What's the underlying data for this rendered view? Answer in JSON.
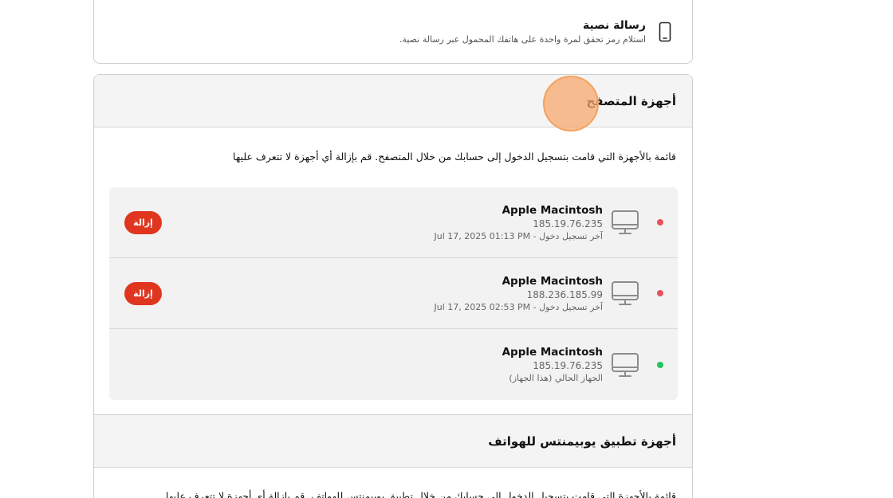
{
  "sms": {
    "title": "رسالة نصية",
    "description": "استلام رمز تحقق لمرة واحدة على هاتفك المحمول عبر رسالة نصية.",
    "icon": "phone-icon"
  },
  "browser_devices": {
    "title": "أجهزة المتصفح",
    "description": "قائمة بالأجهزة التي قامت بتسجيل الدخول إلى حسابك من خلال المتصفح. قم بإزالة أي أجهزة لا تتعرف عليها",
    "devices": [
      {
        "name": "Apple Macintosh",
        "ip": "185.19.76.235",
        "last_login": "آخر تسجيل دخول - Jul 17, 2025 01:13 PM",
        "status_color": "#e8505b",
        "remove_label": "إزالة"
      },
      {
        "name": "Apple Macintosh",
        "ip": "188.236.185.99",
        "last_login": "آخر تسجيل دخول - Jul 17, 2025 02:53 PM",
        "status_color": "#e8505b",
        "remove_label": "إزالة"
      },
      {
        "name": "Apple Macintosh",
        "ip": "185.19.76.235",
        "last_login": "الجهاز الحالي (هذا الجهاز)",
        "status_color": "#22c55e"
      }
    ]
  },
  "mobile_devices": {
    "title": "أجهزة تطبيق يوبيمنتس للهواتف",
    "description": "قائمة بالأجهزة التي قامت بتسجيل الدخول إلى حسابك من خلال تطبيق يوبيمنتس للهواتف. قم بإزالة أي أجهزة لا تتعرف عليها"
  },
  "colors": {
    "remove_button": "#e0361f",
    "active_dot": "#22c55e",
    "inactive_dot": "#e8505b"
  }
}
